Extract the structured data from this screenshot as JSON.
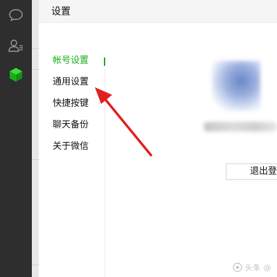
{
  "sidebar": {
    "icons": [
      "chat-bubble-icon",
      "contacts-icon",
      "cube-icon"
    ],
    "active_icon_color": "#1aad19"
  },
  "settings": {
    "title": "设置",
    "nav": [
      {
        "label": "帐号设置",
        "active": true
      },
      {
        "label": "通用设置",
        "active": false
      },
      {
        "label": "快捷按键",
        "active": false
      },
      {
        "label": "聊天备份",
        "active": false
      },
      {
        "label": "关于微信",
        "active": false
      }
    ],
    "logout_label": "退出登"
  },
  "annotation": {
    "arrow_color": "#e02020"
  },
  "watermark": {
    "text": "头条 @"
  }
}
